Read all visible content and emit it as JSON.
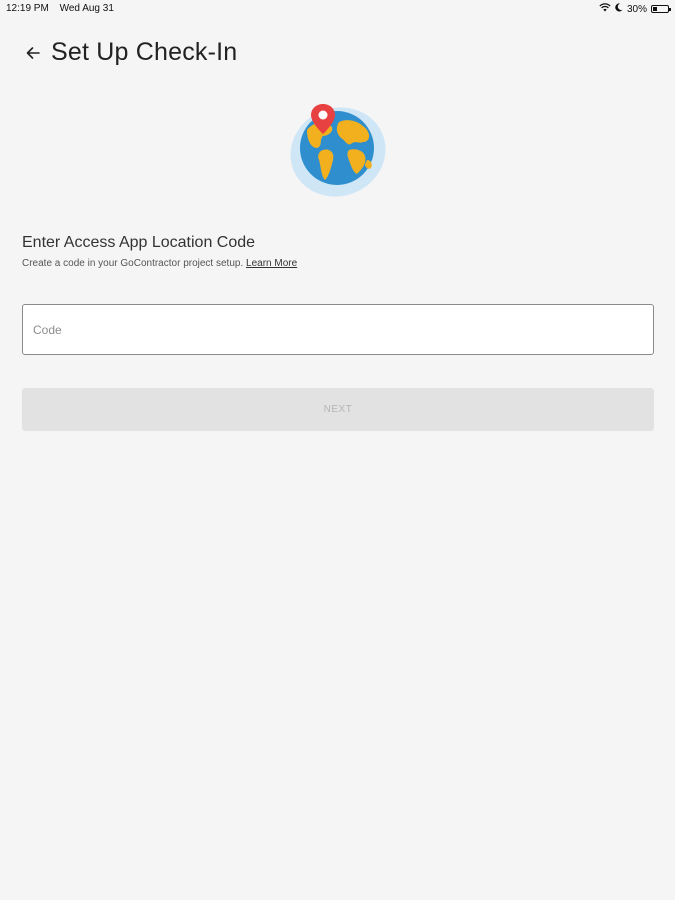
{
  "status_bar": {
    "time": "12:19 PM",
    "date": "Wed Aug 31",
    "battery_text": "30%",
    "battery_level": 0.3,
    "icons": [
      "wifi-icon",
      "moon-icon",
      "battery-icon"
    ]
  },
  "header": {
    "title": "Set Up Check-In",
    "back_icon": "arrow-left-icon"
  },
  "illustration": {
    "icon": "globe-location-pin-icon",
    "colors": {
      "halo": "#cfe6f7",
      "ocean": "#2f8fce",
      "land": "#f2b01e",
      "pin": "#e84141"
    }
  },
  "form": {
    "heading": "Enter Access App Location Code",
    "subtext": "Create a code in your GoContractor project setup.",
    "learn_more": "Learn More",
    "code_placeholder": "Code",
    "code_value": "",
    "next_label": "NEXT",
    "next_enabled": false
  }
}
